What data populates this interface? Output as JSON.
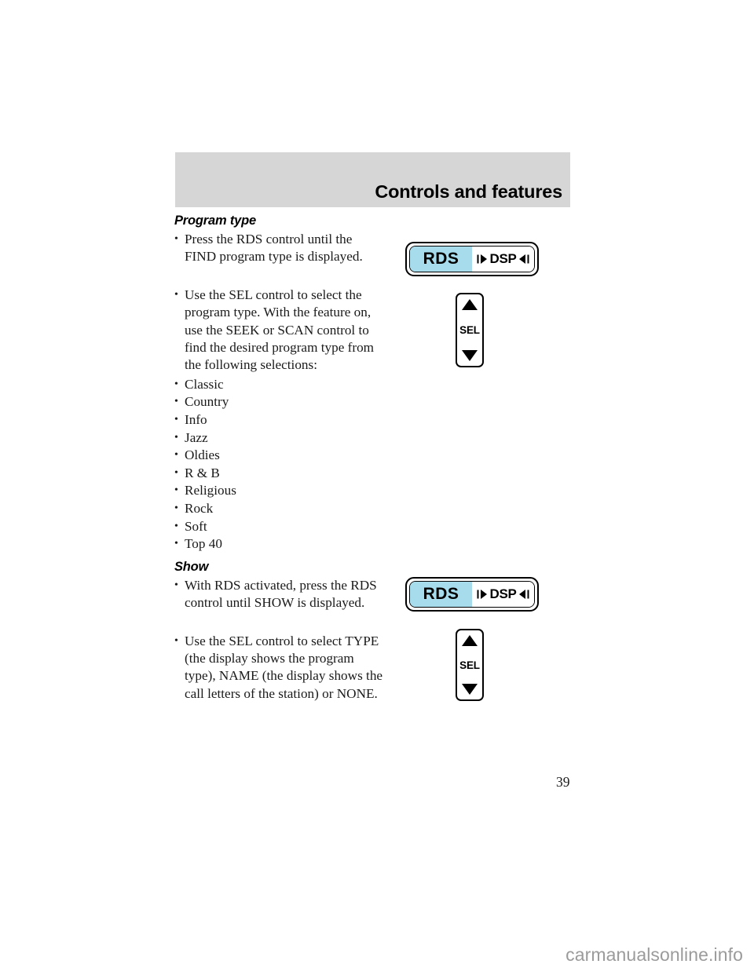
{
  "header": {
    "chapter_title": "Controls and features"
  },
  "sections": [
    {
      "heading": "Program type",
      "bullets": [
        "Press the RDS control until the FIND program type is displayed.",
        "Use the SEL control to select the program type. With the feature on, use the SEEK or SCAN control to find the desired program type from the following selections:"
      ],
      "options": [
        "Classic",
        "Country",
        "Info",
        "Jazz",
        "Oldies",
        "R & B",
        "Religious",
        "Rock",
        "Soft",
        "Top 40"
      ]
    },
    {
      "heading": "Show",
      "bullets": [
        "With RDS activated, press the RDS control until SHOW is displayed.",
        "Use the SEL control to select TYPE (the display shows the program type), NAME (the display shows the call letters of the station) or NONE."
      ]
    }
  ],
  "figures": {
    "rds_button_top": {
      "left_label": "RDS",
      "right_label": "DSP",
      "highlight_color": "#a6dcec"
    },
    "sel_control_top": {
      "label": "SEL",
      "up_icon": "triangle-up-icon",
      "down_icon": "triangle-down-icon"
    },
    "rds_button_bottom": {
      "left_label": "RDS",
      "right_label": "DSP",
      "highlight_color": "#a6dcec"
    },
    "sel_control_bottom": {
      "label": "SEL",
      "up_icon": "triangle-up-icon",
      "down_icon": "triangle-down-icon"
    }
  },
  "bullet_mark": "•",
  "page_number": "39",
  "watermark": "carmanualsonline.info"
}
